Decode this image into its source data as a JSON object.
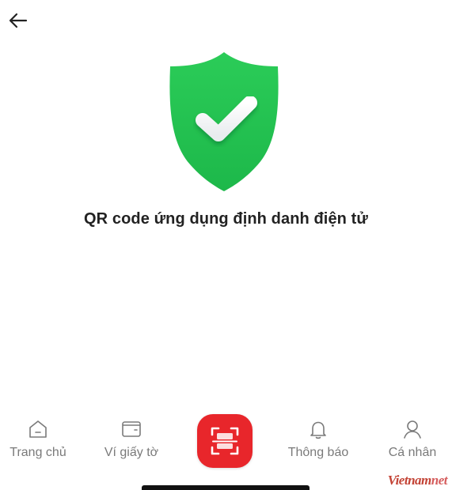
{
  "header": {
    "back_icon": "arrow-left-icon"
  },
  "main": {
    "status_icon": "shield-check-icon",
    "title": "QR code ứng dụng định danh điện tử"
  },
  "bottom_nav": {
    "items": [
      {
        "label": "Trang chủ",
        "icon": "home-icon"
      },
      {
        "label": "Ví giấy tờ",
        "icon": "wallet-icon"
      },
      {
        "label": "Thông báo",
        "icon": "bell-icon"
      },
      {
        "label": "Cá nhân",
        "icon": "user-icon"
      }
    ],
    "scan_icon": "qr-scan-icon"
  },
  "watermark": {
    "brand": "Vietnam",
    "suffix": "net"
  },
  "colors": {
    "shield_green": "#22c55e",
    "scan_red": "#e8262b",
    "nav_gray": "#7a7a7a"
  }
}
